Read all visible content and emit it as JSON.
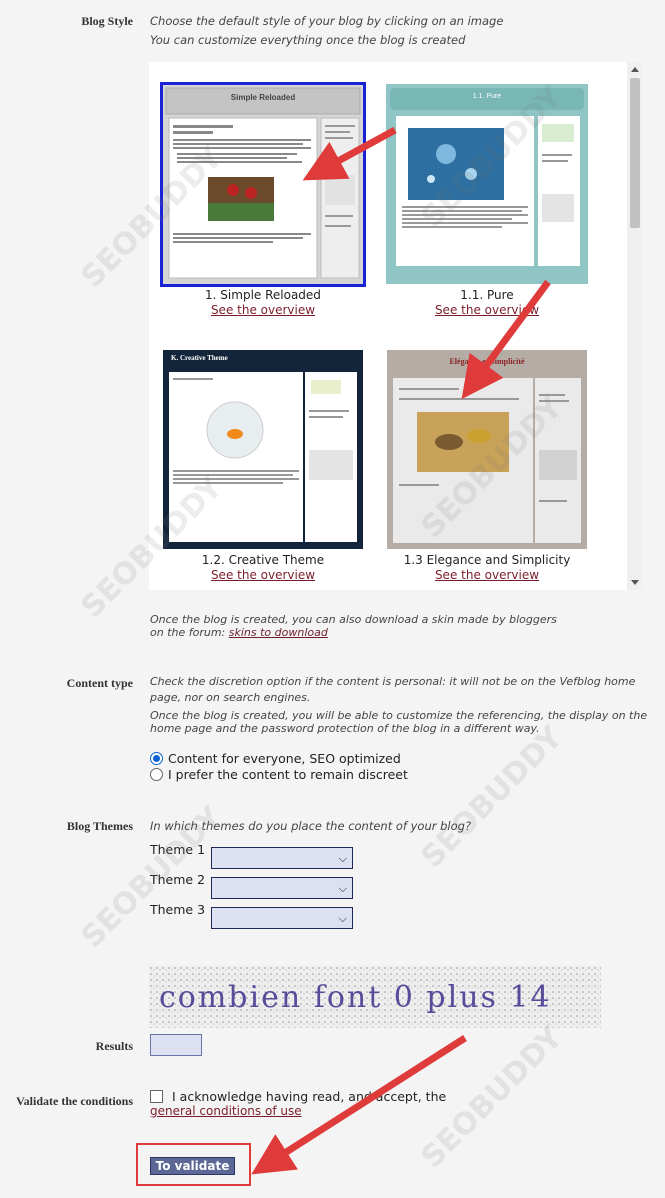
{
  "blog_style": {
    "label": "Blog Style",
    "intro_line1": "Choose the default style of your blog by clicking on an image",
    "intro_line2": "You can customize everything once the blog is created",
    "overview_text": "See the overview",
    "themes": [
      {
        "caption": "1. Simple Reloaded",
        "preview_title": "Simple Reloaded",
        "selected": true
      },
      {
        "caption": "1.1. Pure",
        "preview_title": "1.1. Pure",
        "selected": false
      },
      {
        "caption": "1.2. Creative Theme",
        "preview_title": "K. Creative Theme",
        "selected": false
      },
      {
        "caption": "1.3 Elegance and Simplicity",
        "preview_title": "Elégance et Simplicité",
        "selected": false
      }
    ],
    "skin_line1": "Once the blog is created, you can also download a skin made by bloggers",
    "skin_line2_prefix": "on the forum: ",
    "skin_link": "skins to download"
  },
  "content_type": {
    "label": "Content type",
    "para1_line1": "Check the discretion option if the content is personal: it will not be on the Vefblog home",
    "para1_line2": "page, nor on search engines.",
    "para2_line1": "Once the blog is created, you will be able to customize the referencing, the display on the",
    "para2_line2": "home page and the password protection of the blog in a different way.",
    "options": [
      {
        "label": "Content for everyone, SEO optimized",
        "checked": true
      },
      {
        "label": "I prefer the content to remain discreet",
        "checked": false
      }
    ]
  },
  "blog_themes": {
    "label": "Blog Themes",
    "question": "In which themes do you place the content of your blog?",
    "selects": [
      {
        "label": "Theme 1",
        "value": ""
      },
      {
        "label": "Theme 2",
        "value": ""
      },
      {
        "label": "Theme 3",
        "value": ""
      }
    ]
  },
  "captcha": {
    "text": "combien font 0 plus 14"
  },
  "results": {
    "label": "Results",
    "value": ""
  },
  "conditions": {
    "label": "Validate the conditions",
    "text": "I acknowledge having read, and accept, the",
    "link": "general conditions of use",
    "checked": false
  },
  "submit": {
    "label": "To validate"
  },
  "watermark": "SEOBUDDY",
  "colors": {
    "accent_link": "#7b1e2b",
    "annotation_red": "#e03b3b",
    "selected_border": "#1a22d6",
    "button_bg": "#5d6796",
    "field_bg": "#dde0f0"
  }
}
